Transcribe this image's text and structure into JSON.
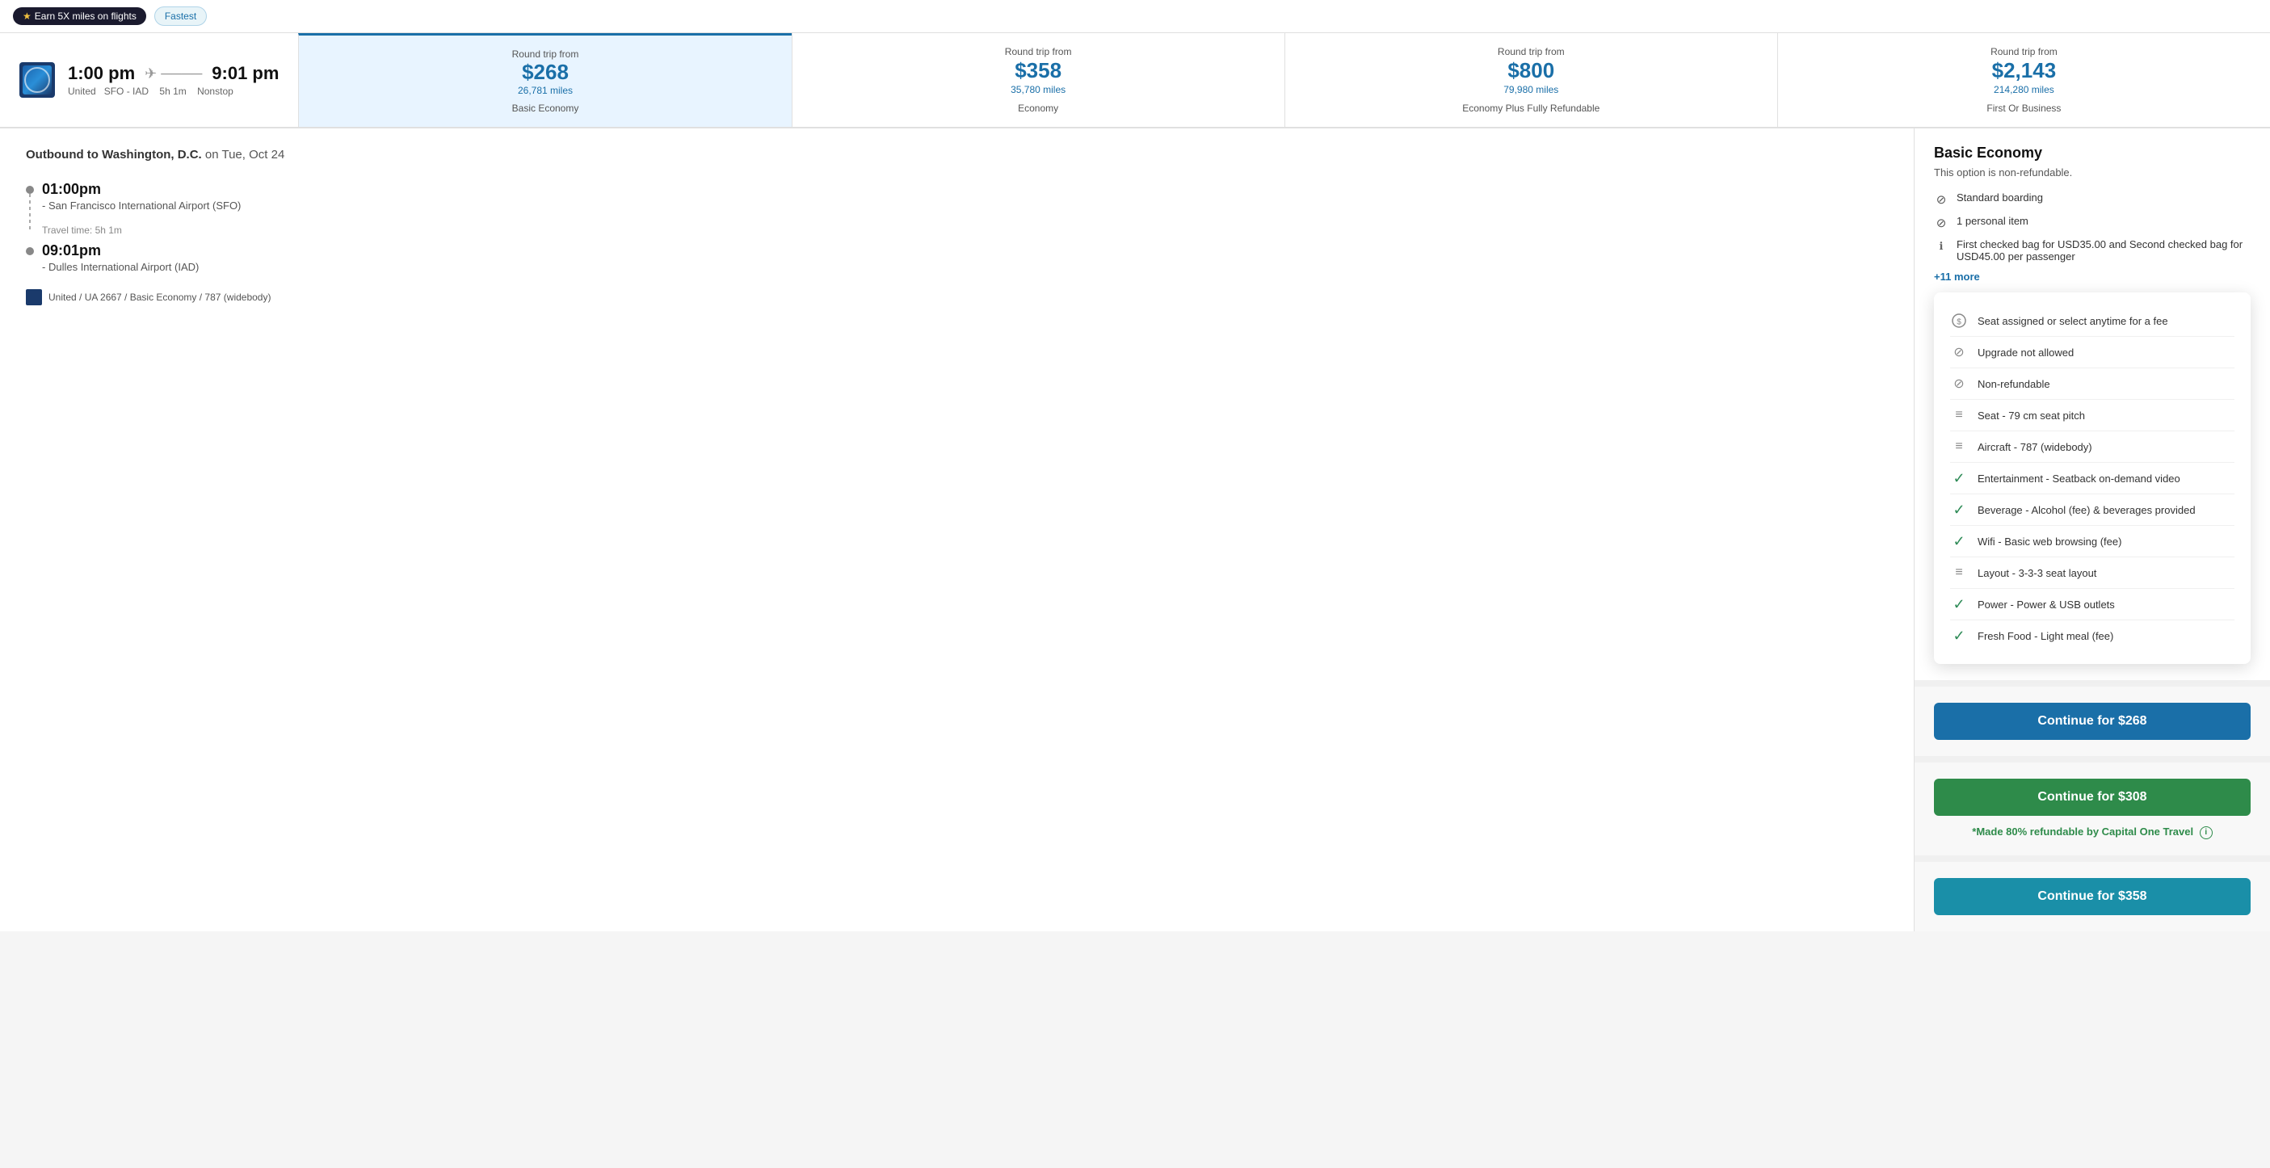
{
  "topBar": {
    "earnBadge": "Earn 5X miles on flights",
    "fastestBadge": "Fastest"
  },
  "flight": {
    "departTime": "1:00 pm",
    "arriveTime": "9:01 pm",
    "airline": "United",
    "route": "SFO - IAD",
    "duration": "5h 1m",
    "stops": "Nonstop"
  },
  "priceCards": [
    {
      "label": "Round trip from",
      "amount": "$268",
      "miles": "26,781 miles",
      "class": "Basic Economy",
      "selected": true
    },
    {
      "label": "Round trip from",
      "amount": "$358",
      "miles": "35,780 miles",
      "class": "Economy",
      "selected": false
    },
    {
      "label": "Round trip from",
      "amount": "$800",
      "miles": "79,980 miles",
      "class": "Economy Plus Fully Refundable",
      "selected": false
    },
    {
      "label": "Round trip from",
      "amount": "$2,143",
      "miles": "214,280 miles",
      "class": "First Or Business",
      "selected": false
    }
  ],
  "outbound": {
    "title": "Outbound to Washington, D.C.",
    "date": " on Tue, Oct 24",
    "depart": {
      "time": "01:00pm",
      "airport": "San Francisco International Airport (SFO)"
    },
    "travelTime": "Travel time: 5h 1m",
    "arrive": {
      "time": "09:01pm",
      "airport": "Dulles International Airport (IAD)"
    },
    "meta": "United / UA 2667 / Basic Economy / 787 (widebody)"
  },
  "fareDetails": {
    "title": "Basic Economy",
    "subtitle": "This option is non-refundable.",
    "items": [
      {
        "icon": "⊘",
        "text": "Standard boarding",
        "iconType": "block"
      },
      {
        "icon": "⊘",
        "text": "1 personal item",
        "iconType": "block"
      },
      {
        "icon": "ℹ",
        "text": "First checked bag for USD35.00 and Second checked bag for USD45.00 per passenger",
        "iconType": "info"
      }
    ],
    "moreLink": "+11 more"
  },
  "popup": {
    "items": [
      {
        "icon": "💲",
        "text": "Seat assigned or select anytime for a fee",
        "iconType": "dollar"
      },
      {
        "icon": "⊘",
        "text": "Upgrade not allowed",
        "iconType": "block"
      },
      {
        "icon": "⊘",
        "text": "Non-refundable",
        "iconType": "block"
      },
      {
        "icon": "≡",
        "text": "Seat - 79 cm seat pitch",
        "iconType": "lines"
      },
      {
        "icon": "≡",
        "text": "Aircraft - 787 (widebody)",
        "iconType": "lines"
      },
      {
        "icon": "✓",
        "text": "Entertainment - Seatback on-demand video",
        "iconType": "check"
      },
      {
        "icon": "✓",
        "text": "Beverage - Alcohol (fee) & beverages provided",
        "iconType": "check"
      },
      {
        "icon": "✓",
        "text": "Wifi - Basic web browsing (fee)",
        "iconType": "check"
      },
      {
        "icon": "≡",
        "text": "Layout - 3-3-3 seat layout",
        "iconType": "lines"
      },
      {
        "icon": "✓",
        "text": "Power - Power & USB outlets",
        "iconType": "check"
      },
      {
        "icon": "✓",
        "text": "Fresh Food - Light meal (fee)",
        "iconType": "check"
      }
    ]
  },
  "buttons": {
    "continueBasic": "Continue for $268",
    "continue308": "Continue for $308",
    "continue358": "Continue for $358",
    "capitalOneNote": "*Made ",
    "capitalOneHighlight": "80% refundable",
    "capitalOneSuffix": " by Capital One Travel"
  }
}
